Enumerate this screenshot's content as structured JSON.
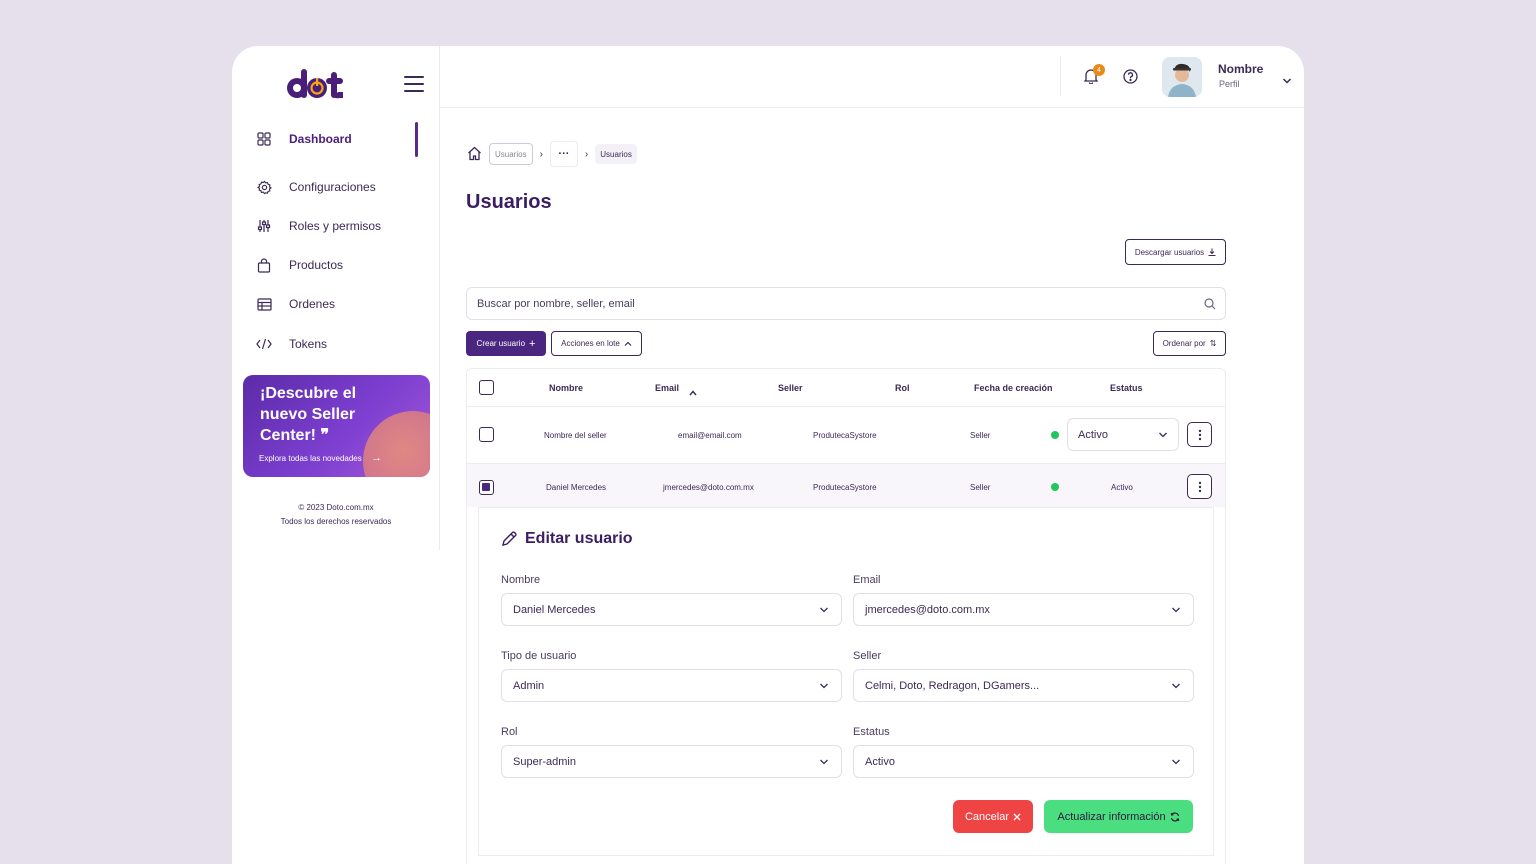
{
  "sidebar": {
    "logo_text": "dot",
    "items": [
      {
        "label": "Dashboard",
        "icon": "grid-icon"
      },
      {
        "label": "Configuraciones",
        "icon": "gear-icon"
      },
      {
        "label": "Roles y permisos",
        "icon": "sliders-icon"
      },
      {
        "label": "Productos",
        "icon": "bag-icon"
      },
      {
        "label": "Ordenes",
        "icon": "table-icon"
      },
      {
        "label": "Tokens",
        "icon": "code-icon"
      }
    ],
    "promo": {
      "title": "¡Descubre el nuevo Seller Center! ❞",
      "subtitle": "Explora todas las novedades",
      "arrow": "→"
    },
    "copyright_line1": "© 2023 Doto.com.mx",
    "copyright_line2": "Todos los derechos reservados"
  },
  "topbar": {
    "notification_count": "4",
    "user_name": "Nombre",
    "user_role": "Perfil"
  },
  "breadcrumb": {
    "first": "Usuarios",
    "middle": "···",
    "current": "Usuarios"
  },
  "page": {
    "title": "Usuarios",
    "download_label": "Descargar usuarios",
    "search_placeholder": "Buscar por nombre, seller, email",
    "create_label": "Crear usuario",
    "batch_label": "Acciones en lote",
    "sort_label": "Ordenar por"
  },
  "table": {
    "columns": [
      "Nombre",
      "Email",
      "Seller",
      "Rol",
      "Fecha de creación",
      "Estatus"
    ],
    "rows": [
      {
        "name": "Nombre del seller",
        "email": "email@email.com",
        "seller": "ProdutecaSystore",
        "role": "Seller",
        "status": "Activo"
      },
      {
        "name": "Daniel Mercedes",
        "email": "jmercedes@doto.com.mx",
        "seller": "ProdutecaSystore",
        "role": "Seller",
        "status": "Activo"
      }
    ]
  },
  "edit": {
    "title": "Editar usuario",
    "fields": {
      "nombre": {
        "label": "Nombre",
        "value": "Daniel Mercedes"
      },
      "email": {
        "label": "Email",
        "value": "jmercedes@doto.com.mx"
      },
      "tipo": {
        "label": "Tipo de usuario",
        "value": "Admin"
      },
      "seller": {
        "label": "Seller",
        "value": "Celmi, Doto, Redragon, DGamers..."
      },
      "rol": {
        "label": "Rol",
        "value": "Super-admin"
      },
      "estatus": {
        "label": "Estatus",
        "value": "Activo"
      }
    },
    "cancel_label": "Cancelar",
    "update_label": "Actualizar información"
  },
  "colors": {
    "brand": "#4a2680",
    "accent": "#f3a712",
    "success": "#4ade80",
    "danger": "#ef4444",
    "status_dot": "#22c55e"
  }
}
